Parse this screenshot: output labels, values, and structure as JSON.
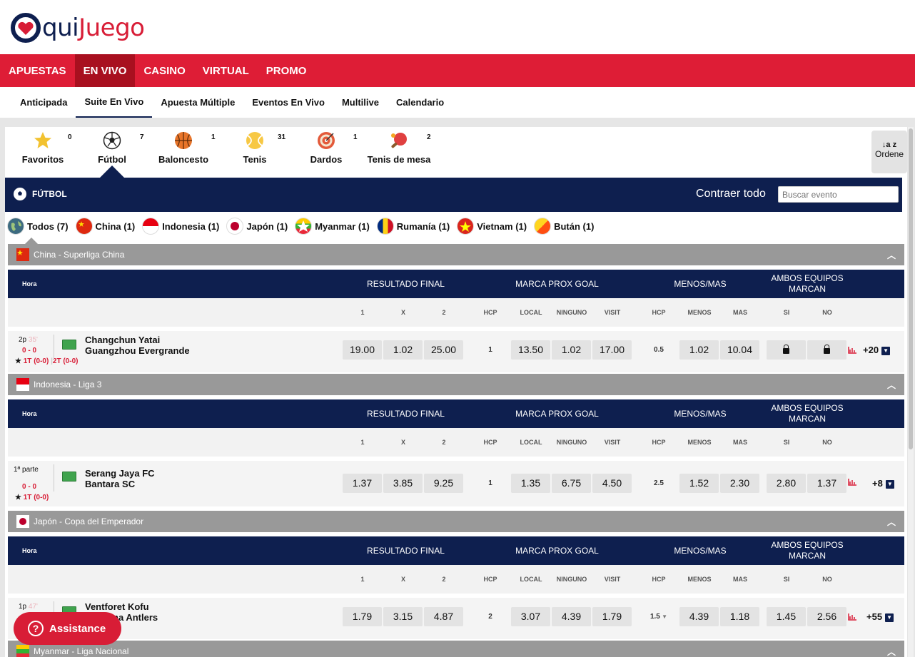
{
  "brand": {
    "logo_text_a": "qui",
    "logo_text_b": "Juego"
  },
  "topnav": [
    {
      "label": "APUESTAS"
    },
    {
      "label": "EN VIVO"
    },
    {
      "label": "CASINO"
    },
    {
      "label": "VIRTUAL"
    },
    {
      "label": "PROMO"
    }
  ],
  "subnav": [
    {
      "label": "Anticipada"
    },
    {
      "label": "Suite En Vivo"
    },
    {
      "label": "Apuesta Múltiple"
    },
    {
      "label": "Eventos En Vivo"
    },
    {
      "label": "Multilive"
    },
    {
      "label": "Calendario"
    }
  ],
  "sports": [
    {
      "label": "Favoritos",
      "count": "0"
    },
    {
      "label": "Fútbol",
      "count": "7"
    },
    {
      "label": "Baloncesto",
      "count": "1"
    },
    {
      "label": "Tenis",
      "count": "31"
    },
    {
      "label": "Dardos",
      "count": "1"
    },
    {
      "label": "Tenis de mesa",
      "count": "2"
    }
  ],
  "sort_label": "Ordene",
  "section": {
    "title": "FÚTBOL",
    "collapse_label": "Contraer todo",
    "search_placeholder": "Buscar evento"
  },
  "countries": [
    {
      "label": "Todos",
      "count": "(7)"
    },
    {
      "label": "China",
      "count": "(1)"
    },
    {
      "label": "Indonesia",
      "count": "(1)"
    },
    {
      "label": "Japón",
      "count": "(1)"
    },
    {
      "label": "Myanmar",
      "count": "(1)"
    },
    {
      "label": "Rumanía",
      "count": "(1)"
    },
    {
      "label": "Vietnam",
      "count": "(1)"
    },
    {
      "label": "Bután",
      "count": "(1)"
    }
  ],
  "headers": {
    "hora": "Hora",
    "resultado": "RESULTADO FINAL",
    "marca": "MARCA PROX GOAL",
    "menos_mas": "MENOS/MAS",
    "ambos": "AMBOS EQUIPOS MARCAN"
  },
  "subheaders": [
    "1",
    "X",
    "2",
    "HCP",
    "LOCAL",
    "NINGUNO",
    "VISIT",
    "HCP",
    "MENOS",
    "MAS",
    "SI",
    "NO"
  ],
  "leagues": [
    {
      "name": "China - Superliga China",
      "event": {
        "time": "2p",
        "minute": "35'",
        "score": "0 - 0",
        "half1": "1T (0-0)",
        "half2": "2T (0-0)",
        "team1": "Changchun Yatai",
        "team2": "Guangzhou Evergrande",
        "res": [
          "19.00",
          "1.02",
          "25.00"
        ],
        "hcp": "1",
        "goal": [
          "13.50",
          "1.02",
          "17.00"
        ],
        "ou_hcp": "0.5",
        "ou": [
          "1.02",
          "10.04"
        ],
        "btts": [
          "",
          ""
        ],
        "more": "+20"
      }
    },
    {
      "name": "Indonesia - Liga 3",
      "event": {
        "time": "1ª parte",
        "minute": "",
        "score": "0 - 0",
        "half1": "1T (0-0)",
        "half2": "",
        "team1": "Serang Jaya FC",
        "team2": "Bantara SC",
        "res": [
          "1.37",
          "3.85",
          "9.25"
        ],
        "hcp": "1",
        "goal": [
          "1.35",
          "6.75",
          "4.50"
        ],
        "ou_hcp": "2.5",
        "ou": [
          "1.52",
          "2.30"
        ],
        "btts": [
          "2.80",
          "1.37"
        ],
        "more": "+8"
      }
    },
    {
      "name": "Japón - Copa del Emperador",
      "event": {
        "time": "1p",
        "minute": "47'",
        "score": "",
        "half1": "",
        "half2": "",
        "team1": "Ventforet Kofu",
        "team2": "Kashima Antlers",
        "res": [
          "1.79",
          "3.15",
          "4.87"
        ],
        "hcp": "2",
        "goal": [
          "3.07",
          "4.39",
          "1.79"
        ],
        "ou_hcp": "1.5",
        "ou": [
          "4.39",
          "1.18"
        ],
        "btts": [
          "1.45",
          "2.56"
        ],
        "more": "+55"
      }
    },
    {
      "name": "Myanmar - Liga Nacional"
    }
  ],
  "assistance": "Assistance",
  "colors": {
    "navy": "#0e1f4f",
    "red": "#de1d36",
    "dark_red": "#a8101f",
    "grey_league": "#999999"
  }
}
